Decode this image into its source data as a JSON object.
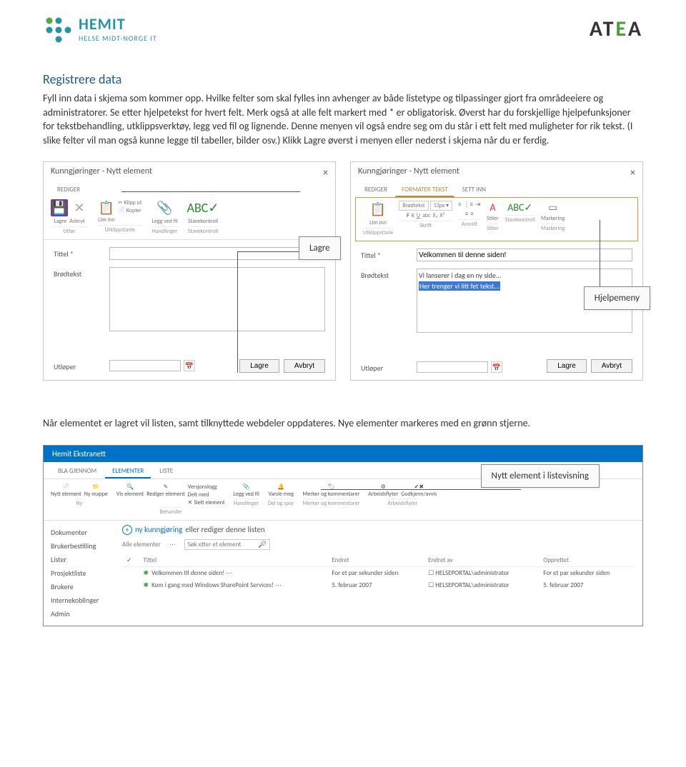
{
  "header": {
    "hemit_name": "HEMIT",
    "hemit_sub": "HELSE MIDT-NORGE IT",
    "atea": "ATEA"
  },
  "section": {
    "heading": "Registrere data",
    "para": "Fyll inn data i skjema som kommer opp. Hvilke felter som skal fylles inn avhenger av både listetype og tilpassinger gjort fra områdeeiere og administratorer. Se etter hjelpetekst for hvert felt. Merk også at alle felt markert med * er obligatorisk. Øverst har du forskjellige hjelpefunksjoner for tekstbehandling, utklippsverktøy, legg ved fil og lignende. Denne menyen vil også endre seg om du står i ett felt med muligheter for rik tekst. (I slike felter vil man også kunne legge til tabeller, bilder osv.) Klikk Lagre øverst i menyen eller nederst i skjema når du er ferdig."
  },
  "dialog": {
    "title": "Kunngjøringer - Nytt element",
    "tab_rediger": "REDIGER",
    "tab_formater": "FORMATER TEKST",
    "tab_settinn": "SETT INN",
    "lbl_tittel": "Tittel *",
    "lbl_brodtekst": "Brødtekst",
    "lbl_utloper": "Utløper",
    "btn_lagre": "Lagre",
    "btn_avbryt": "Avbryt",
    "ribbon": {
      "lagre": "Lagre",
      "avbryt": "Avbryt",
      "lim_inn": "Lim inn",
      "klipp_ut": "Klipp ut",
      "kopier": "Kopier",
      "legg_ved_fil": "Legg ved fil",
      "stavekontroll": "Stavekontroll",
      "utfor": "Utfør",
      "utklippstavle": "Utklippstavle",
      "handlinger": "Handlinger",
      "brodtekst": "Brødtekst",
      "skrift": "Skrift",
      "avsnitt": "Avsnitt",
      "stiler": "Stiler",
      "markering": "Markering"
    },
    "right": {
      "tittel_val": "Velkommen til denne siden!",
      "line1": "Vi lanserer i dag en ny side...",
      "line2": "Her trenger vi litt fet tekst..."
    }
  },
  "callouts": {
    "lagre": "Lagre",
    "hjelpemeny": "Hjelpemeny",
    "nytt": "Nytt element i listevisning"
  },
  "after_para": "Når elementet er lagret vil listen, samt tilknyttede webdeler oppdateres. Nye elementer markeres med en grønn stjerne.",
  "list": {
    "top": "Hemit Ekstranett",
    "nav_bla": "BLA GJENNOM",
    "nav_elementer": "ELEMENTER",
    "nav_liste": "LISTE",
    "ribbon": {
      "nytt_element": "Nytt element",
      "ny_mappe": "Ny mappe",
      "vis_element": "Vis element",
      "rediger_element": "Rediger element",
      "versjonslogg": "Versjonslogg",
      "delt_med": "Delt med",
      "slett_element": "Slett element",
      "legg_ved_fil": "Legg ved fil",
      "varsle_meg": "Varsle meg",
      "merker_kommentarer": "Merker og kommentarer",
      "arbeidsflyter": "Arbeidsflyter",
      "godkjenn": "Godkjenn/avvis",
      "grp_ny": "Ny",
      "grp_behandle": "Behandle",
      "grp_handlinger": "Handlinger",
      "grp_del": "Del og spor",
      "grp_merker": "Merker og kommentarer",
      "grp_arbeidsflyter": "Arbeidsflyter"
    },
    "sidebar": [
      "Dokumenter",
      "Brukerbestilling",
      "Lister",
      "Prosjektliste",
      "Brukere",
      "Internekoblinger",
      "Admin"
    ],
    "new_text": "ny kunngjøring",
    "new_suffix": " eller rediger denne listen",
    "all": "Alle elementer",
    "search": "Søk etter et element",
    "cols": {
      "tittel": "Tittel",
      "endret": "Endret",
      "endret_av": "Endret av",
      "opprettet": "Opprettet"
    },
    "rows": [
      {
        "tittel": "Velkommen til denne siden!",
        "star": true,
        "endret": "For et par sekunder siden",
        "endret_av": "HELSEPORTAL\\administrator",
        "opprettet": "For et par sekunder siden"
      },
      {
        "tittel": "Kom i gang med Windows SharePoint Services!",
        "star": true,
        "endret": "5. februar 2007",
        "endret_av": "HELSEPORTAL\\administrator",
        "opprettet": "5. februar 2007"
      }
    ]
  }
}
